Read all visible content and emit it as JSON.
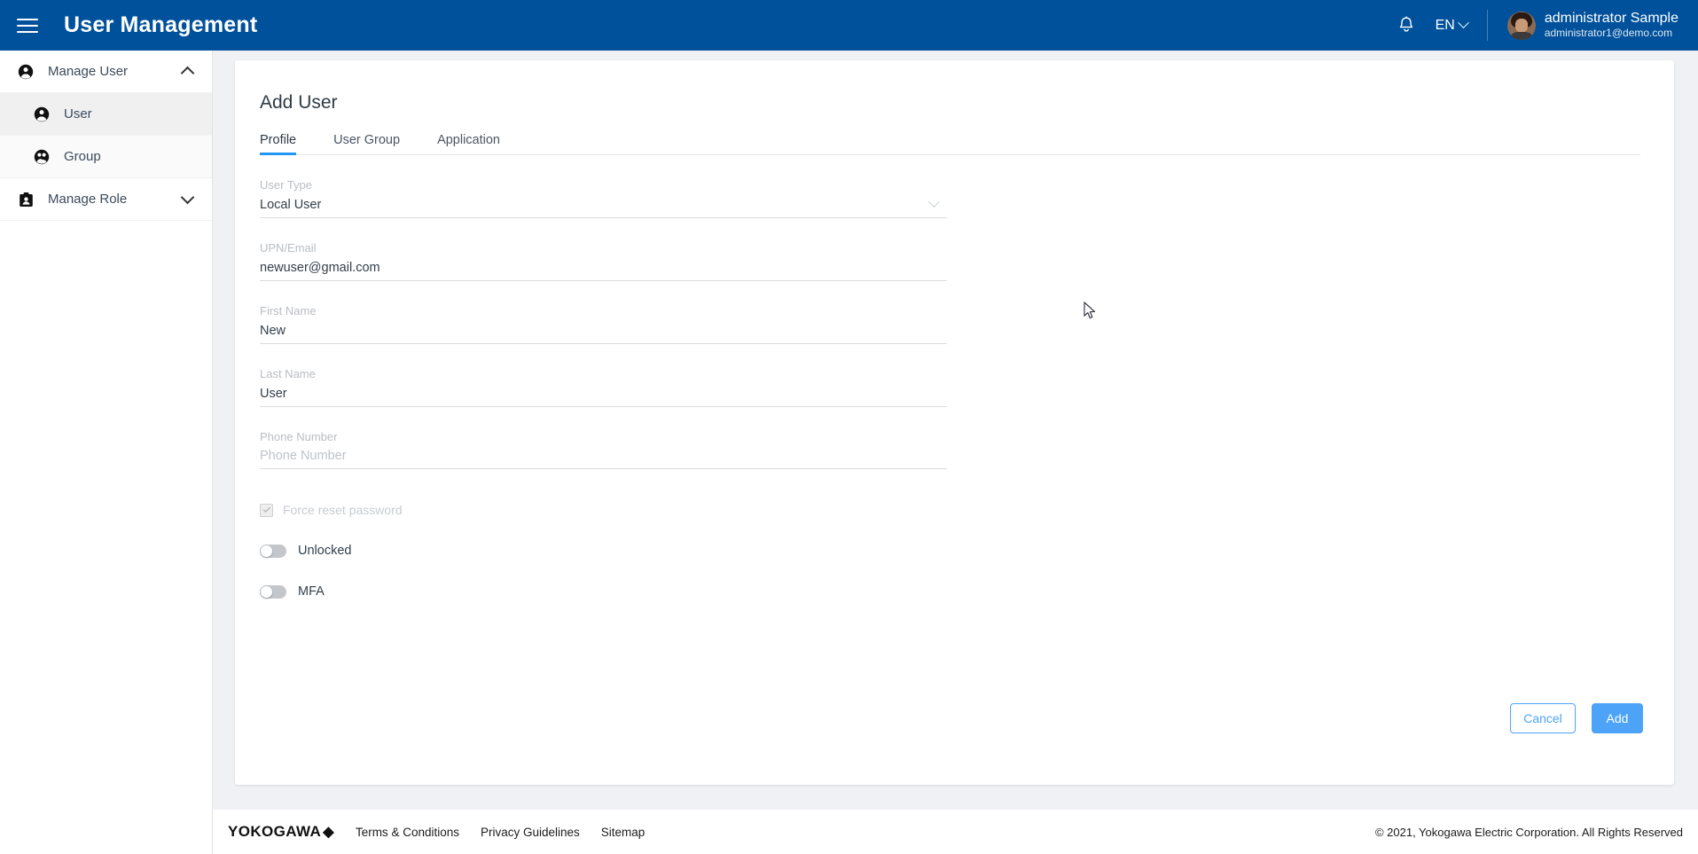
{
  "header": {
    "menu_icon": "hamburger-icon",
    "title": "User Management",
    "bell_icon": "bell-icon",
    "language": "EN",
    "user_name": "administrator Sample",
    "user_email": "administrator1@demo.com"
  },
  "sidebar": {
    "items": [
      {
        "label": "Manage User",
        "icon": "user-icon",
        "caret": "up",
        "level": "top",
        "selected": false
      },
      {
        "label": "User",
        "icon": "user-icon",
        "level": "sub",
        "selected": true
      },
      {
        "label": "Group",
        "icon": "group-icon",
        "level": "sub",
        "selected": false
      },
      {
        "label": "Manage Role",
        "icon": "badge-icon",
        "caret": "down",
        "level": "top",
        "selected": false
      }
    ]
  },
  "main": {
    "page_title": "Add User",
    "tabs": [
      {
        "label": "Profile",
        "active": true
      },
      {
        "label": "User Group",
        "active": false
      },
      {
        "label": "Application",
        "active": false
      }
    ],
    "fields": [
      {
        "label": "User Type",
        "value": "Local User",
        "placeholder": "",
        "type": "select"
      },
      {
        "label": "UPN/Email",
        "value": "newuser@gmail.com",
        "placeholder": "",
        "type": "text"
      },
      {
        "label": "First Name",
        "value": "New",
        "placeholder": "",
        "type": "text"
      },
      {
        "label": "Last Name",
        "value": "User",
        "placeholder": "",
        "type": "text"
      },
      {
        "label": "Phone Number",
        "value": "",
        "placeholder": "Phone Number",
        "type": "text"
      }
    ],
    "checkbox": {
      "label": "Force reset password",
      "checked": true,
      "disabled": true
    },
    "toggles": [
      {
        "label": "Unlocked",
        "on": false
      },
      {
        "label": "MFA",
        "on": false
      }
    ],
    "cancel_label": "Cancel",
    "add_label": "Add"
  },
  "footer": {
    "brand": "YOKOGAWA",
    "brand_mark": "◆",
    "links": [
      "Terms & Conditions",
      "Privacy Guidelines",
      "Sitemap"
    ],
    "copyright": "© 2021, Yokogawa Electric Corporation. All Rights Reserved"
  },
  "colors": {
    "header_blue": "#00519b",
    "accent_blue": "#2196f3",
    "button_blue": "#4da3f7",
    "page_bg": "#eff1f5"
  }
}
